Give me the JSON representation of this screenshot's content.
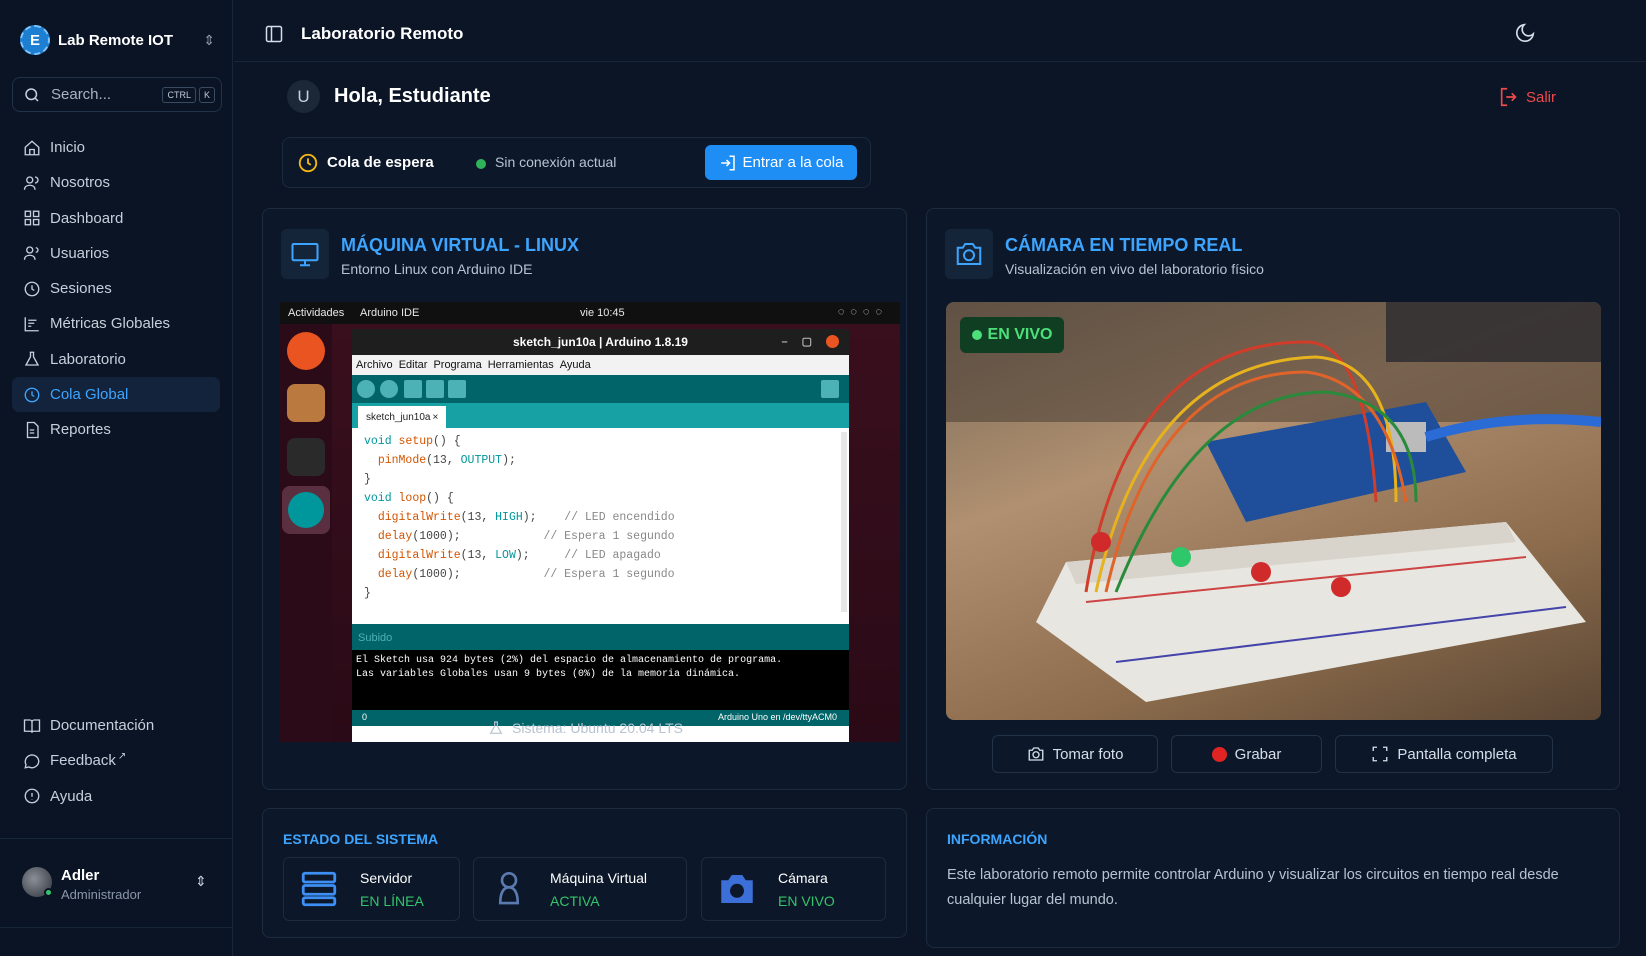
{
  "sidebar": {
    "brand": "Lab Remote IOT",
    "search_placeholder": "Search...",
    "kbd": [
      "CTRL",
      "K"
    ],
    "items": [
      {
        "label": "Inicio",
        "icon": "home-icon"
      },
      {
        "label": "Nosotros",
        "icon": "users-icon"
      },
      {
        "label": "Dashboard",
        "icon": "dashboard-icon"
      },
      {
        "label": "Usuarios",
        "icon": "user-group-icon"
      },
      {
        "label": "Sesiones",
        "icon": "clock-icon"
      },
      {
        "label": "Métricas Globales",
        "icon": "chart-icon"
      },
      {
        "label": "Laboratorio",
        "icon": "flask-icon"
      },
      {
        "label": "Cola Global",
        "icon": "clock-icon",
        "active": true
      },
      {
        "label": "Reportes",
        "icon": "file-icon"
      }
    ],
    "bottom_items": [
      {
        "label": "Documentación",
        "icon": "book-icon"
      },
      {
        "label": "Feedback",
        "icon": "message-icon"
      },
      {
        "label": "Ayuda",
        "icon": "help-icon"
      }
    ],
    "user": {
      "name": "Adler",
      "role": "Administrador"
    }
  },
  "topbar": {
    "title": "Laboratorio Remoto"
  },
  "greeting": {
    "avatar_letter": "U",
    "text": "Hola, Estudiante",
    "logout": "Salir"
  },
  "queue": {
    "title": "Cola de espera",
    "status": "Sin conexión actual",
    "button": "Entrar a la cola"
  },
  "vm": {
    "title": "MÁQUINA VIRTUAL - LINUX",
    "subtitle": "Entorno Linux con Arduino IDE",
    "footer": "Sistema: Ubuntu 20.04 LTS",
    "screen": {
      "activities": "Actividades",
      "app": "Arduino IDE",
      "clock": "vie 10:45",
      "window_title": "sketch_jun10a | Arduino 1.8.19",
      "menu": [
        "Archivo",
        "Editar",
        "Programa",
        "Herramientas",
        "Ayuda"
      ],
      "tab": "sketch_jun10a",
      "status": "Subido",
      "console": [
        "El Sketch usa 924 bytes (2%) del espacio de almacenamiento de programa.",
        "Las variables Globales usan 9 bytes (0%) de la memoria dinámica."
      ],
      "footer_left": "0",
      "footer_right": "Arduino Uno en /dev/ttyACM0"
    }
  },
  "camera": {
    "title": "CÁMARA EN TIEMPO REAL",
    "subtitle": "Visualización en vivo del laboratorio físico",
    "live": "EN VIVO",
    "buttons": [
      "Tomar foto",
      "Grabar",
      "Pantalla completa"
    ]
  },
  "system_status": {
    "title": "ESTADO DEL SISTEMA",
    "items": [
      {
        "name": "Servidor",
        "value": "EN LÍNEA"
      },
      {
        "name": "Máquina Virtual",
        "value": "ACTIVA"
      },
      {
        "name": "Cámara",
        "value": "EN VIVO"
      }
    ]
  },
  "info": {
    "title": "INFORMACIÓN",
    "text": "Este laboratorio remoto permite controlar Arduino y visualizar los circuitos en tiempo real desde cualquier lugar del mundo."
  },
  "colors": {
    "accent": "#3da5ff",
    "primary_button": "#1e8ef5",
    "success": "#34c46a",
    "danger": "#ef4a4a",
    "background": "#0b1526"
  }
}
